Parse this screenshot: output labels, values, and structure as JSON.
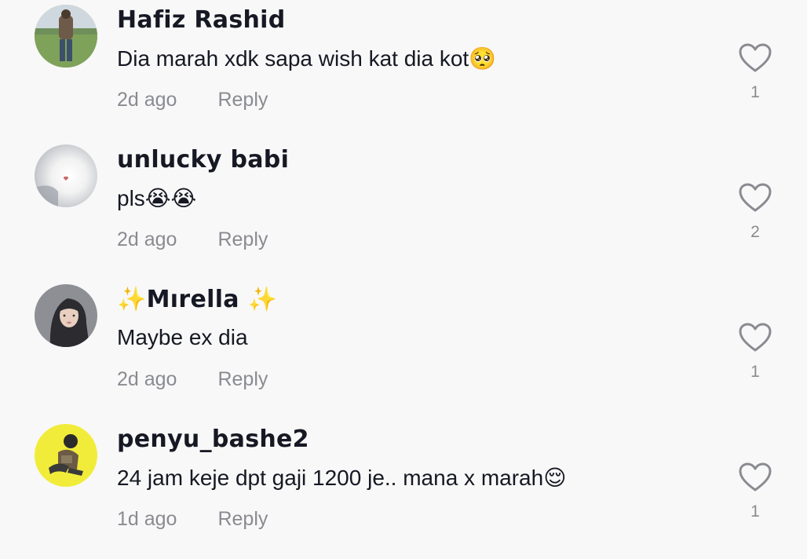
{
  "comments": [
    {
      "username": "Hafiz Rashid",
      "text": "Dia marah xdk sapa wish kat dia kot",
      "emoji": "🥺",
      "time": "2d ago",
      "reply": "Reply",
      "likes": "1",
      "avatar": "photo-man-standing-on-grass"
    },
    {
      "username": "unlucky babi",
      "text": "pls",
      "emoji": "😭😭",
      "time": "2d ago",
      "reply": "Reply",
      "likes": "2",
      "avatar": "photo-bright-light"
    },
    {
      "username": "Mırella",
      "sparkle_left": "✨",
      "sparkle_right": "✨",
      "text": "Maybe ex dia",
      "emoji": "",
      "time": "2d ago",
      "reply": "Reply",
      "likes": "1",
      "avatar": "photo-woman-hijab"
    },
    {
      "username": "penyu_bashe2",
      "text": "24 jam keje dpt gaji 1200 je.. mana x marah",
      "emoji": "😌",
      "time": "1d ago",
      "reply": "Reply",
      "likes": "1",
      "avatar": "photo-person-on-yellow"
    }
  ],
  "icons": {
    "like": "heart-outline-icon"
  },
  "colors": {
    "background": "#f8f8f8",
    "text": "#161823",
    "muted": "#8a8b91"
  }
}
